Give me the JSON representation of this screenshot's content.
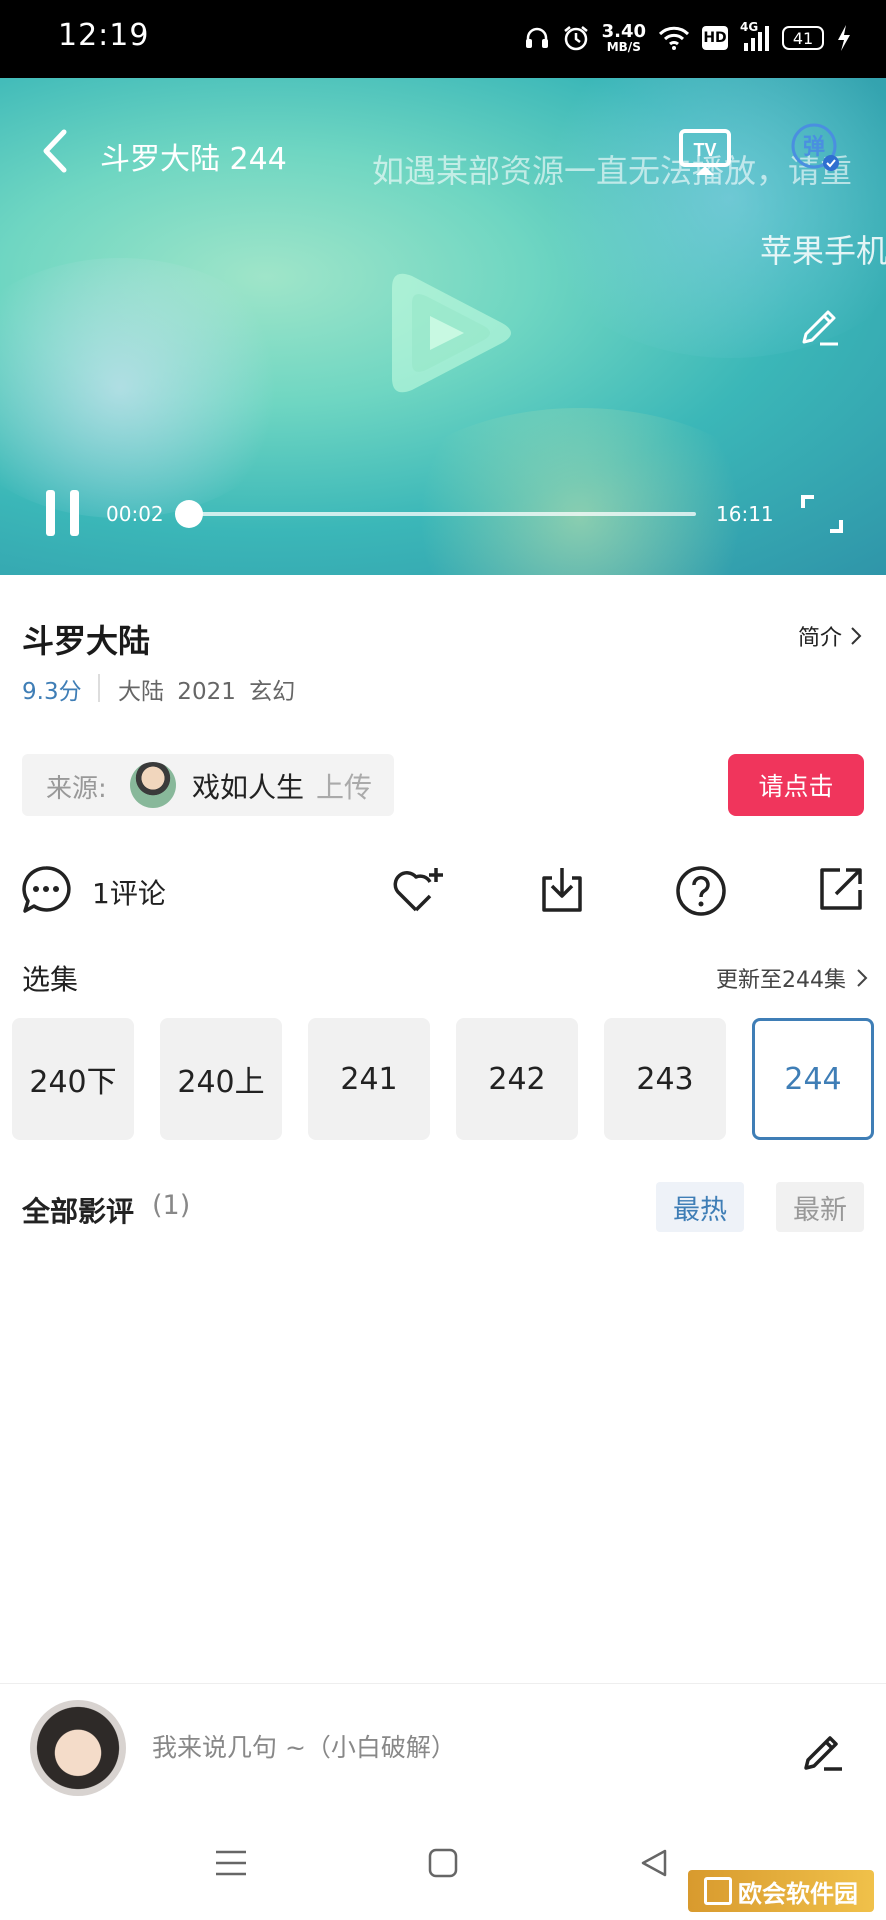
{
  "status_bar": {
    "time": "12:19",
    "net_speed_value": "3.40",
    "net_speed_unit": "MB/S",
    "hd": "HD",
    "signal": "4G",
    "battery": "41"
  },
  "player": {
    "title": "斗罗大陆 244",
    "danmaku": [
      "如遇某部资源一直无法播放，请重",
      "苹果手机"
    ],
    "current_time": "00:02",
    "total_time": "16:11",
    "progress": 0.002,
    "tv_label": "TV",
    "danmaku_toggle_label": "弹"
  },
  "info": {
    "title": "斗罗大陆",
    "intro_label": "简介",
    "rating": "9.3分",
    "meta": "大陆 2021 玄幻",
    "source_label": "来源:",
    "uploader": "戏如人生",
    "upload_suffix": "上传",
    "request_button": "请点击"
  },
  "actions": {
    "comment_count": "1评论"
  },
  "episodes": {
    "label": "选集",
    "update_text": "更新至244集",
    "items": [
      {
        "label": "240下",
        "active": false
      },
      {
        "label": "240上",
        "active": false
      },
      {
        "label": "241",
        "active": false
      },
      {
        "label": "242",
        "active": false
      },
      {
        "label": "243",
        "active": false
      },
      {
        "label": "244",
        "active": true
      }
    ]
  },
  "reviews": {
    "label": "全部影评",
    "count": "(1)",
    "sort_hot": "最热",
    "sort_new": "最新"
  },
  "comment_bar": {
    "placeholder": "我来说几句 ~（小白破解）"
  },
  "watermark": {
    "text": "欧会软件园"
  },
  "colors": {
    "accent_blue": "#3f7eb6",
    "request_red": "#f0355c"
  }
}
